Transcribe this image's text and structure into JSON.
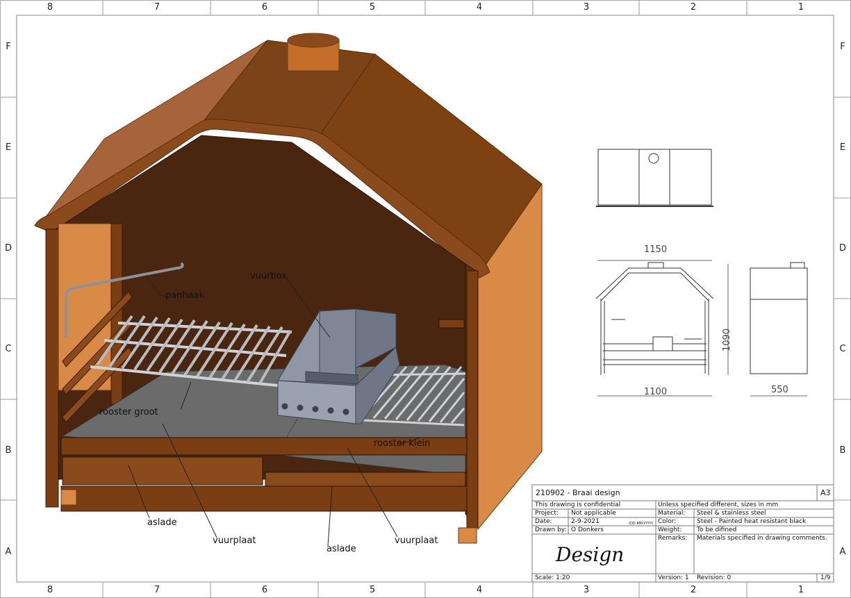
{
  "zones": {
    "columns": [
      "8",
      "7",
      "6",
      "5",
      "4",
      "3",
      "2",
      "1"
    ],
    "rows": [
      "F",
      "E",
      "D",
      "C",
      "B",
      "A"
    ]
  },
  "callouts": {
    "panhaak": "panhaak",
    "vuurbox": "vuurbox",
    "rooster_groot": "rooster groot",
    "rooster_klein": "rooster klein",
    "aslade_left": "aslade",
    "aslade_right": "aslade",
    "vuurplaat_left": "vuurplaat",
    "vuurplaat_right": "vuurplaat"
  },
  "dimensions": {
    "width_top": "1150",
    "width_bottom": "1100",
    "height": "1090",
    "depth": "550"
  },
  "title_block": {
    "title": "210902 - Braai design",
    "sheet_size": "A3",
    "confidential": "This drawing is confidential",
    "project_label": "Project:",
    "project_value": "Not applicable",
    "date_label": "Date:",
    "date_value": "2-9-2021",
    "date_format": "(DD-MM-YYYY)",
    "drawn_label": "Drawn by:",
    "drawn_value": "O Donkers",
    "note": "Unless specified different, sizes in mm",
    "material_label": "Material:",
    "material_value": "Steel & stainless steel",
    "color_label": "Color:",
    "color_value": "Steel - Painted heat resistant black",
    "weight_label": "Weight:",
    "weight_value": "To be difined",
    "remarks_label": "Remarks:",
    "remarks_value": "Materials specified in drawing comments.",
    "logo_text": "Design",
    "scale": "Scale: 1:20",
    "version": "Version: 1",
    "revision": "Revision: 0",
    "page": "1/9"
  },
  "colors": {
    "roof_left": "#a7643a",
    "roof_front": "#7a4418",
    "roof_right": "#7e4212",
    "side_outer": "#d98a47",
    "interior": "#4a2610",
    "floor": "#6b6b6b",
    "firebox": "#7f8796",
    "grill": "#b9bcc0",
    "line": "#333333"
  }
}
